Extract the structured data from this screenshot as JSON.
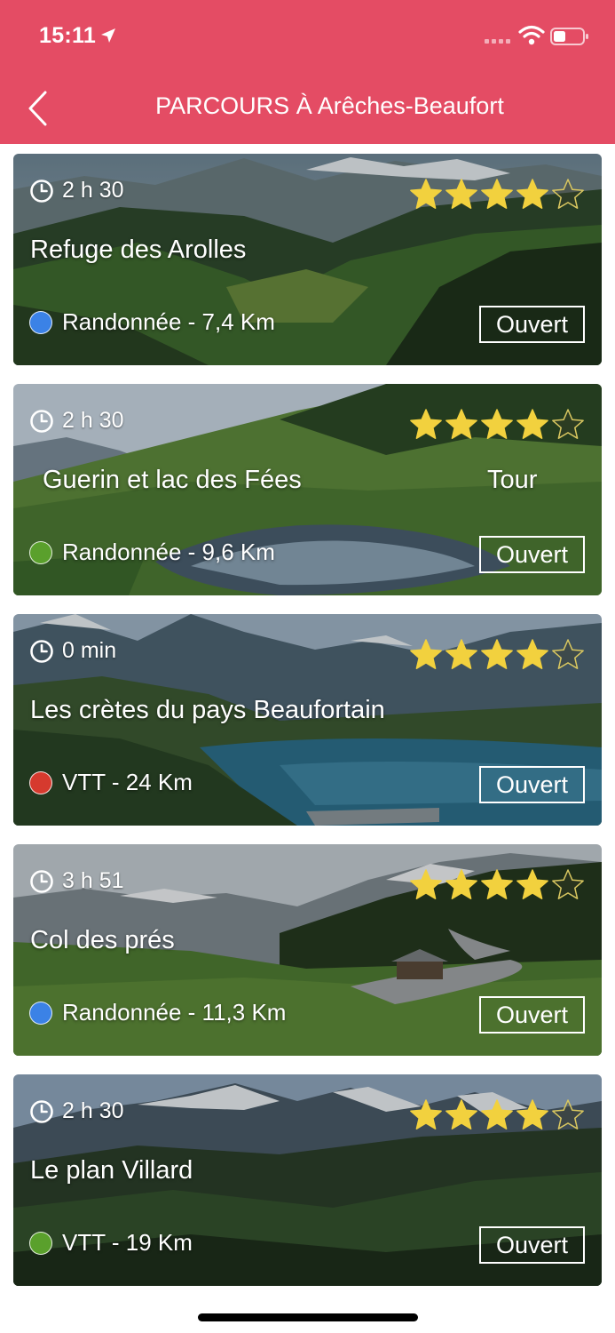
{
  "status_bar": {
    "time": "15:11"
  },
  "nav": {
    "title": "PARCOURS À Arêches-Beaufort"
  },
  "colors": {
    "header": "#e44c64",
    "star": "#f2d13e",
    "blue": "#3b82e6",
    "green": "#5aa02c",
    "red": "#d63a2e"
  },
  "cards": [
    {
      "duration": "2 h 30",
      "title": "Refuge des Arolles",
      "extra": "",
      "activity": "Randonnée - 7,4 Km",
      "dot_color": "#3b82e6",
      "status": "Ouvert",
      "rating": 4,
      "rating_max": 5
    },
    {
      "duration": "2 h 30",
      "title": "Guerin et lac des Fées",
      "extra": "Tour",
      "activity": "Randonnée - 9,6 Km",
      "dot_color": "#5aa02c",
      "status": "Ouvert",
      "rating": 4,
      "rating_max": 5
    },
    {
      "duration": "0 min",
      "title": "Les crètes du pays Beaufortain",
      "extra": "",
      "activity": "VTT - 24 Km",
      "dot_color": "#d63a2e",
      "status": "Ouvert",
      "rating": 4,
      "rating_max": 5
    },
    {
      "duration": "3 h 51",
      "title": "Col des prés",
      "extra": "",
      "activity": "Randonnée - 11,3 Km",
      "dot_color": "#3b82e6",
      "status": "Ouvert",
      "rating": 4,
      "rating_max": 5
    },
    {
      "duration": "2 h 30",
      "title": "Le plan Villard",
      "extra": "",
      "activity": "VTT - 19 Km",
      "dot_color": "#5aa02c",
      "status": "Ouvert",
      "rating": 4,
      "rating_max": 5
    }
  ]
}
